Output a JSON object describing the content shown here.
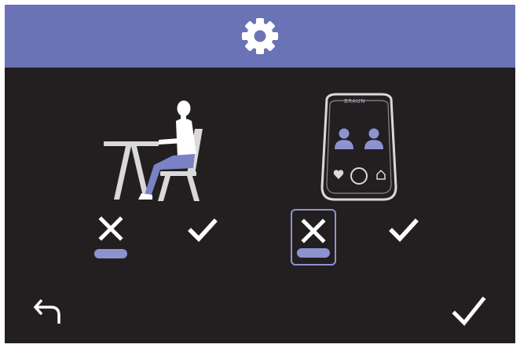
{
  "header": {
    "icon": "gear-icon",
    "color": "#6a73b5"
  },
  "options": [
    {
      "id": "posture",
      "illustration": "person-seated-at-desk-icon",
      "choices": [
        {
          "icon": "x-icon",
          "selected": true
        },
        {
          "icon": "check-icon",
          "selected": false
        }
      ]
    },
    {
      "id": "multi-user",
      "illustration": "device-two-users-icon",
      "device_logo": "BRAUN",
      "choices": [
        {
          "icon": "x-icon",
          "selected": true,
          "focused": true
        },
        {
          "icon": "check-icon",
          "selected": false
        }
      ]
    }
  ],
  "footer": {
    "back_icon": "back-arrow-icon",
    "confirm_icon": "check-icon"
  },
  "colors": {
    "background": "#231f20",
    "accent": "#8d93cf",
    "header": "#6a73b5",
    "foreground": "#ffffff",
    "illustration": "#d9d9d9"
  }
}
